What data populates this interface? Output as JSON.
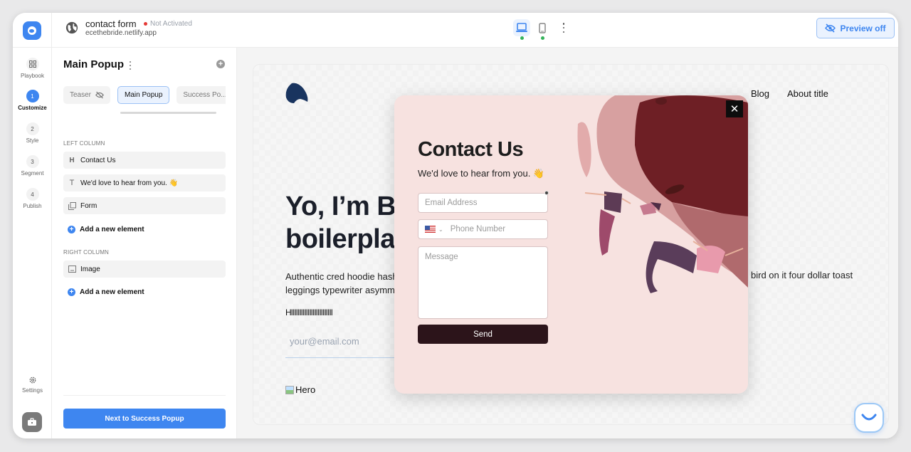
{
  "topbar": {
    "site_title": "contact form",
    "status": "Not Activated",
    "status_color": "#e53935",
    "site_url": "ecethebride.netlify.app",
    "preview_label": "Preview off",
    "devices": [
      {
        "name": "desktop",
        "active": true
      },
      {
        "name": "mobile",
        "active": false
      }
    ]
  },
  "rail": {
    "items": [
      {
        "label": "Playbook",
        "icon": "grid-icon"
      },
      {
        "label": "Customize",
        "step": "1",
        "active": true
      },
      {
        "label": "Style",
        "step": "2"
      },
      {
        "label": "Segment",
        "step": "3"
      },
      {
        "label": "Publish",
        "step": "4"
      }
    ],
    "settings_label": "Settings"
  },
  "panel": {
    "title": "Main Popup",
    "tabs": [
      {
        "label": "Teaser",
        "hidden_icon": true
      },
      {
        "label": "Main Popup",
        "active": true
      },
      {
        "label": "Success Po..."
      }
    ],
    "left_column_label": "LEFT COLUMN",
    "left_elements": [
      {
        "icon": "H",
        "label": "Contact Us"
      },
      {
        "icon": "T",
        "label": "We'd love to hear from you. 👋"
      },
      {
        "icon": "form",
        "label": "Form"
      }
    ],
    "add_element_label": "Add a new element",
    "right_column_label": "RIGHT COLUMN",
    "right_elements": [
      {
        "icon": "image",
        "label": "Image"
      }
    ],
    "next_button": "Next to Success Popup"
  },
  "site": {
    "nav": [
      "Blog",
      "About title"
    ],
    "hero_title_line1": "Yo, I’m Blu",
    "hero_title_line2": "boilerplat",
    "hero_text_line1": "Authentic cred hoodie hash",
    "hero_text_line2": "leggings typewriter asymm",
    "hero_text_right": "bird on it four dollar toast",
    "hero_h": "HIIIIIIIIIIIIIIIIIIIIIIIII",
    "email_placeholder": "your@email.com",
    "hero_image_alt": "Hero"
  },
  "popup": {
    "title": "Contact Us",
    "subtitle": "We'd love to hear from you. 👋",
    "email_placeholder": "Email Address",
    "phone_placeholder": "Phone Number",
    "message_placeholder": "Message",
    "send_label": "Send",
    "close_label": "✕",
    "background": "#f7e2e0",
    "button_color": "#2c141a"
  }
}
